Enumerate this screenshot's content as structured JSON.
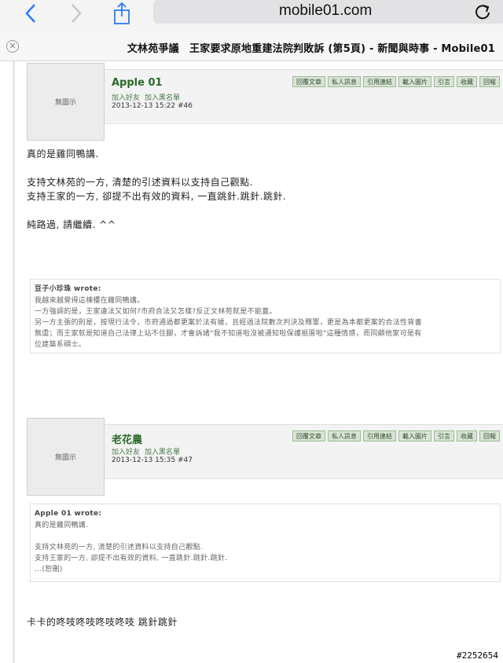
{
  "browser": {
    "url": "mobile01.com",
    "tab_title": "文林苑爭議　王家要求原地重建法院判敗訴 (第5頁) - 新聞與時事 - Mobile01"
  },
  "posts": [
    {
      "avatar_text": "無圖示",
      "author": "Apple 01",
      "add_friend": "加入好友",
      "add_blacklist": "加入黑名單",
      "meta": "2013-12-13 15:22  #46",
      "buttons": [
        "回覆文章",
        "私人訊息",
        "引用連結",
        "載入圖片",
        "引言",
        "收藏",
        "回報"
      ],
      "body": [
        "真的是雞同鴨講.",
        "",
        "支持文林苑的一方, 清楚的引述資料以支持自己觀點.",
        "支持王家的一方, 卻提不出有效的資料, 一直跳針.跳針.跳針.",
        "",
        "純路過, 請繼續. ^^"
      ],
      "quote": {
        "header": "豆子小珍珠 wrote:",
        "lines": [
          "我越來越覺得這棟樓在雞同鴨講。",
          "一方強調的是，王家違法又如何?市府合法又怎樣?反正文林苑就是不能蓋。",
          "另一方主張的則是，按現行法令，市府通過都更案於法有據，且經過法院數次判決及釋憲，更是為本都更案的合法性背書",
          "無虞；而王家就是知道自己法律上站不住腳，才會訴諸\"我不知道啦沒被通知啦保護祖厝啦\"這種情感，而同顧他家可是有",
          "位建築系碩士。"
        ]
      }
    },
    {
      "avatar_text": "無圖示",
      "author": "老花農",
      "add_friend": "加入好友",
      "add_blacklist": "加入黑名單",
      "meta": "2013-12-13 15:35  #47",
      "buttons": [
        "回覆文章",
        "私人訊息",
        "引用連結",
        "載入圖片",
        "引言",
        "收藏",
        "回報"
      ],
      "quote": {
        "header": "Apple 01 wrote:",
        "lines": [
          "真的是雞同鴨講.",
          "",
          "支持文林苑的一方, 清楚的引述資料以支持自己觀點.",
          "支持王家的一方, 卻提不出有效的資料, 一直跳針.跳針.跳針.",
          "...(恕刪)"
        ]
      },
      "body": [
        "卡卡的咚吱咚吱咚吱咚吱 跳針跳針"
      ]
    }
  ],
  "watermark": "#2252654"
}
